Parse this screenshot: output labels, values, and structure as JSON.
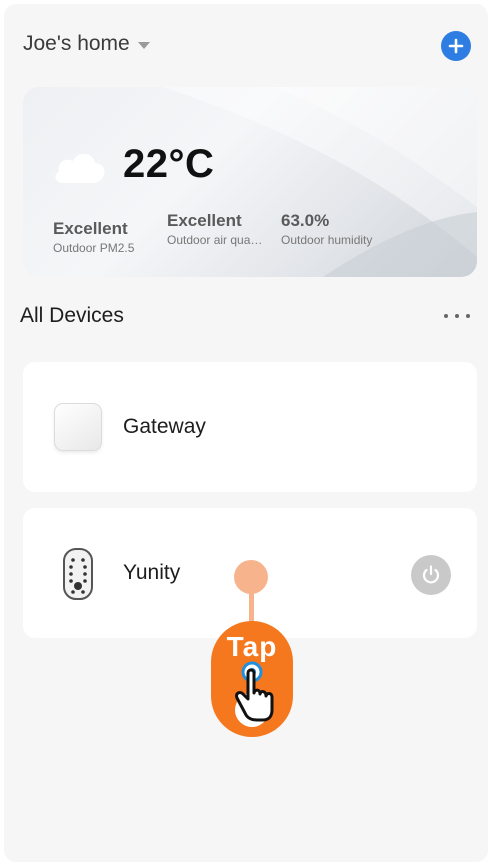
{
  "header": {
    "home_name": "Joe's home",
    "icons": {
      "dropdown": "chevron-down-icon",
      "add": "plus-icon"
    },
    "accent_color": "#2e7de3"
  },
  "weather": {
    "temperature": "22°C",
    "icon": "cloud-icon",
    "metrics": [
      {
        "value": "Excellent",
        "label": "Outdoor PM2.5"
      },
      {
        "value": "Excellent",
        "label": "Outdoor air qua…"
      },
      {
        "value": "63.0%",
        "label": "Outdoor humidity"
      }
    ]
  },
  "devices_section": {
    "title": "All Devices",
    "more_icon": "more-horizontal-icon"
  },
  "devices": [
    {
      "name": "Gateway",
      "icon": "gateway-icon"
    },
    {
      "name": "Yunity",
      "icon": "smart-lock-icon",
      "power_icon": "power-icon"
    }
  ],
  "overlay": {
    "tap_label": "Tap",
    "color": "#f5781e"
  }
}
